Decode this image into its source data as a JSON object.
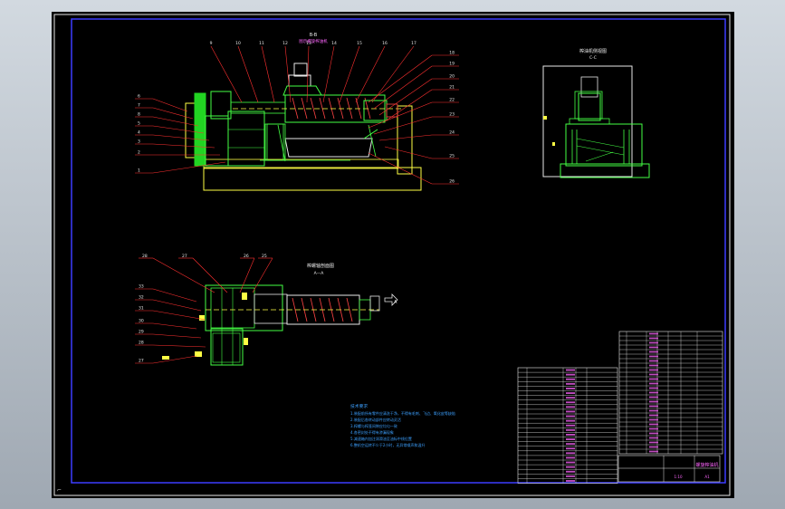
{
  "views": {
    "front_title": "B-B",
    "front_subtitle": "图示螺旋榨油机",
    "side_title": "榨油机侧视图",
    "side_subtitle": "C-C",
    "section_title": "榨螺轴剖面图",
    "section_subtitle": "A—A",
    "section_mark": "A"
  },
  "front_callouts_left": [
    "6",
    "7",
    "8",
    "5",
    "4",
    "3",
    "2",
    "1"
  ],
  "front_callouts_top": [
    "9",
    "10",
    "11",
    "12",
    "13",
    "14",
    "15",
    "16",
    "17"
  ],
  "front_callouts_right": [
    "18",
    "19",
    "20",
    "21",
    "22",
    "23",
    "24",
    "25",
    "26"
  ],
  "section_callouts_top": [
    "28",
    "27",
    "26",
    "25"
  ],
  "section_callouts_left": [
    "33",
    "32",
    "31",
    "30",
    "29",
    "28",
    "27"
  ],
  "notes": {
    "heading": "技术要求",
    "lines": [
      "1.装配前所有零件应清洗干净，不得有毛刺、飞边、氧化皮等缺陷",
      "2.装配后各转动部件应转动灵活",
      "3.榨螺与榨笼间隙应均匀一致",
      "4.各密封处不得有渗漏现象",
      "5.减速箱内加注润滑油至油标中线位置",
      "6.整机空运转不少于2小时，无异常噪声和温升"
    ]
  },
  "title_block": {
    "drawing_name": "螺旋榨油机",
    "scale": "1:10",
    "sheet": "A1"
  }
}
